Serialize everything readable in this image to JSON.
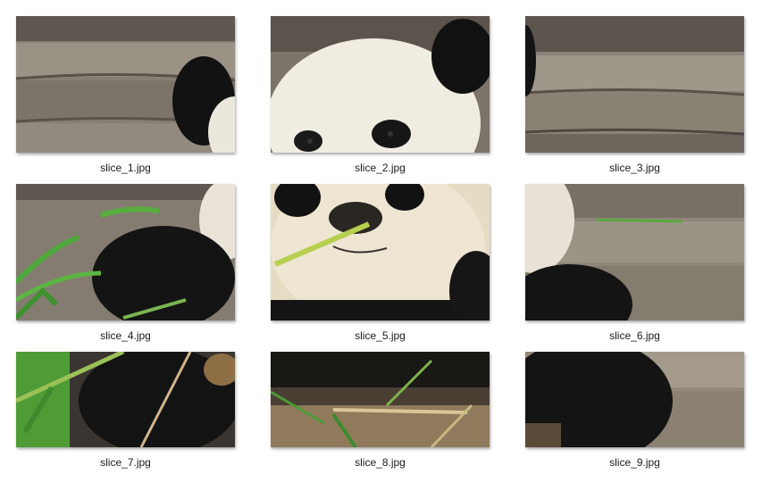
{
  "files": [
    {
      "name": "slice_1.jpg"
    },
    {
      "name": "slice_2.jpg"
    },
    {
      "name": "slice_3.jpg"
    },
    {
      "name": "slice_4.jpg"
    },
    {
      "name": "slice_5.jpg"
    },
    {
      "name": "slice_6.jpg"
    },
    {
      "name": "slice_7.jpg"
    },
    {
      "name": "slice_8.jpg"
    },
    {
      "name": "slice_9.jpg"
    }
  ],
  "colors": {
    "background": "#ffffff",
    "wood": "#8a8177",
    "fur_white": "#f1ede4",
    "fur_black": "#151515",
    "bamboo_green": "#4ea83a"
  }
}
